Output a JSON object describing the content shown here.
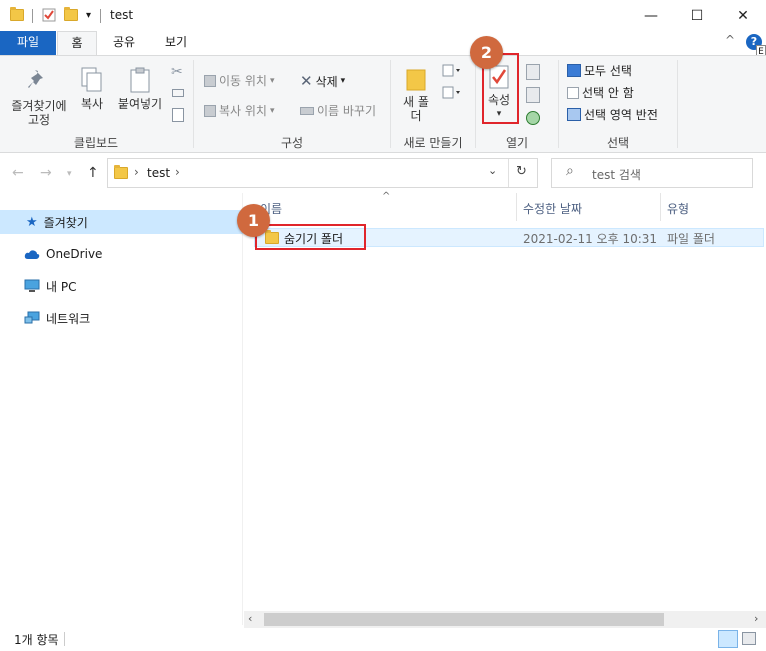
{
  "window": {
    "title": "test",
    "minimize_glyph": "—",
    "maximize_glyph": "☐",
    "close_glyph": "✕",
    "help_glyph": "?",
    "collapse_glyph": "^",
    "edge_letter": "E"
  },
  "ribbon_tabs": [
    "파일",
    "홈",
    "공유",
    "보기"
  ],
  "ribbon": {
    "clipboard": {
      "pin_label": "즐겨찾기에 고정",
      "copy_label": "복사",
      "paste_label": "붙여넣기",
      "group_label": "클립보드"
    },
    "organize": {
      "move_to": "이동 위치",
      "copy_to": "복사 위치",
      "delete": "삭제",
      "rename": "이름 바꾸기",
      "group_label": "구성"
    },
    "new": {
      "new_folder": "새 폴더",
      "group_label": "새로 만들기"
    },
    "open": {
      "properties": "속성",
      "group_label": "열기"
    },
    "select": {
      "select_all": "모두 선택",
      "select_none": "선택 안 함",
      "invert": "선택 영역 반전",
      "group_label": "선택"
    }
  },
  "address": {
    "path": "test",
    "separator": "›",
    "search_placeholder": "test 검색"
  },
  "nav_pane": [
    {
      "label": "즐겨찾기",
      "icon": "star-icon"
    },
    {
      "label": "OneDrive",
      "icon": "cloud-icon"
    },
    {
      "label": "내 PC",
      "icon": "computer-icon"
    },
    {
      "label": "네트워크",
      "icon": "network-icon"
    }
  ],
  "columns": [
    "이름",
    "수정한 날짜",
    "유형"
  ],
  "files": [
    {
      "name": "숨기기 폴더",
      "modified": "2021-02-11 오후 10:31",
      "type": "파일 폴더"
    }
  ],
  "status": {
    "count": "1개 항목"
  },
  "callouts": [
    "1",
    "2"
  ],
  "colors": {
    "accent": "#1a66c2",
    "callout": "#d0693e",
    "highlight": "#e0252b",
    "selection": "#cce8ff"
  }
}
